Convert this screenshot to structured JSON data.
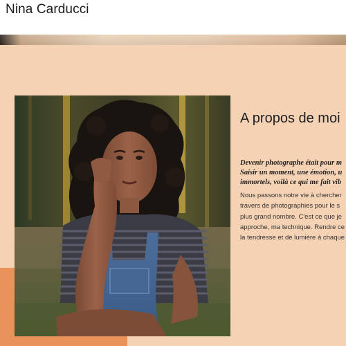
{
  "header": {
    "site_title": "Nina Carducci"
  },
  "about": {
    "title": "A propos de moi",
    "intro_lines": [
      "Devenir photographe était pour m",
      "Saisir un moment, une émotion, u",
      "immortels, voilà ce qui me fait vib"
    ],
    "body_lines": [
      "Nous passons notre vie à chercher",
      "travers de photographies pour le s",
      "plus grand nombre. C'est ce que je",
      "approche, ma technique. Rendre ce",
      "la tendresse et de lumière à chaque"
    ],
    "photo_description_icon": "portrait-photo"
  },
  "colors": {
    "section_bg": "#f6d2b4",
    "accent": "#e9925a",
    "text": "#1f1f1f"
  }
}
